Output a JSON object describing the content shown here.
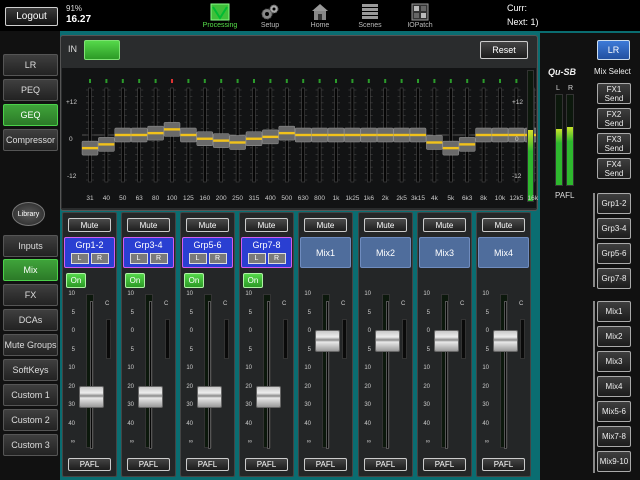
{
  "top": {
    "logout_label": "Logout",
    "battery": "91%",
    "clock": "16.27",
    "nav": [
      {
        "label": "Processing",
        "icon": "processing-icon",
        "active": true
      },
      {
        "label": "Setup",
        "icon": "gears-icon",
        "active": false
      },
      {
        "label": "Home",
        "icon": "home-icon",
        "active": false
      },
      {
        "label": "Scenes",
        "icon": "scenes-icon",
        "active": false
      },
      {
        "label": "IOPatch",
        "icon": "iopatch-icon",
        "active": false
      }
    ],
    "curr_label": "Curr:",
    "next_label": "Next: 1)"
  },
  "left_processing": [
    {
      "label": "LR",
      "selected": false
    },
    {
      "label": "PEQ",
      "selected": false
    },
    {
      "label": "GEQ",
      "selected": true
    },
    {
      "label": "Compressor",
      "selected": false
    }
  ],
  "library_label": "Library",
  "left_layers": [
    {
      "label": "Inputs",
      "selected": false
    },
    {
      "label": "Mix",
      "selected": true
    },
    {
      "label": "FX",
      "selected": false
    },
    {
      "label": "DCAs",
      "selected": false
    },
    {
      "label": "Mute Groups",
      "selected": false
    },
    {
      "label": "SoftKeys",
      "selected": false
    },
    {
      "label": "Custom 1",
      "selected": false
    },
    {
      "label": "Custom 2",
      "selected": false
    },
    {
      "label": "Custom 3",
      "selected": false
    }
  ],
  "geq": {
    "in_label": "IN",
    "in_on": true,
    "reset_label": "Reset",
    "scale_top": "+12",
    "scale_mid": "0",
    "scale_bot": "-12",
    "bands": [
      "31",
      "40",
      "50",
      "63",
      "80",
      "100",
      "125",
      "160",
      "200",
      "250",
      "315",
      "400",
      "500",
      "630",
      "800",
      "1k",
      "1k25",
      "1k6",
      "2k",
      "2k5",
      "3k15",
      "4k",
      "5k",
      "6k3",
      "8k",
      "10k",
      "12k5",
      "16k"
    ],
    "gains_db": [
      -3.5,
      -2.5,
      0,
      0,
      0.5,
      1.5,
      0,
      -1,
      -1.5,
      -2,
      -1,
      -0.5,
      0.5,
      0,
      0,
      0,
      0,
      0,
      0,
      0,
      0,
      -2,
      -3.5,
      -2.5,
      0,
      0,
      0,
      0
    ]
  },
  "strips": [
    {
      "mute": "Mute",
      "name": "Grp1-2",
      "type": "group",
      "l": "L",
      "r": "R",
      "on": "On",
      "pafl": "PAFL",
      "fader_db": -30
    },
    {
      "mute": "Mute",
      "name": "Grp3-4",
      "type": "group",
      "l": "L",
      "r": "R",
      "on": "On",
      "pafl": "PAFL",
      "fader_db": -30
    },
    {
      "mute": "Mute",
      "name": "Grp5-6",
      "type": "group",
      "l": "L",
      "r": "R",
      "on": "On",
      "pafl": "PAFL",
      "fader_db": -30
    },
    {
      "mute": "Mute",
      "name": "Grp7-8",
      "type": "group",
      "l": "L",
      "r": "R",
      "on": "On",
      "pafl": "PAFL",
      "fader_db": -30
    },
    {
      "mute": "Mute",
      "name": "Mix1",
      "type": "mix",
      "pafl": "PAFL",
      "fader_db": -5
    },
    {
      "mute": "Mute",
      "name": "Mix2",
      "type": "mix",
      "pafl": "PAFL",
      "fader_db": -5
    },
    {
      "mute": "Mute",
      "name": "Mix3",
      "type": "mix",
      "pafl": "PAFL",
      "fader_db": -5
    },
    {
      "mute": "Mute",
      "name": "Mix4",
      "type": "mix",
      "pafl": "PAFL",
      "fader_db": -5
    }
  ],
  "fader_scale": [
    "10",
    "5",
    "0",
    "5",
    "10",
    "20",
    "30",
    "40",
    "∞"
  ],
  "clip_label": "C",
  "master": {
    "mute": "Mute",
    "name": "LR",
    "pafl": "PAFL",
    "fader_db": -10
  },
  "right": {
    "mix_btn": "LR",
    "model": "Qu-SB",
    "mix_select_label": "Mix Select",
    "meter_l": "L",
    "meter_r": "R",
    "pafl": "PAFL",
    "fx_sends": [
      "FX1\nSend",
      "FX2\nSend",
      "FX3\nSend",
      "FX4\nSend"
    ],
    "groups": [
      "Grp1-2",
      "Grp3-4",
      "Grp5-6",
      "Grp7-8"
    ],
    "mixes": [
      "Mix1",
      "Mix2",
      "Mix3",
      "Mix4",
      "Mix5-6",
      "Mix7-8",
      "Mix9-10"
    ]
  },
  "colors": {
    "active_green": "#4bd14a",
    "group_blue": "#2a3fd2",
    "mix_blue": "#4f6d9c",
    "teal": "#0a6d71"
  }
}
